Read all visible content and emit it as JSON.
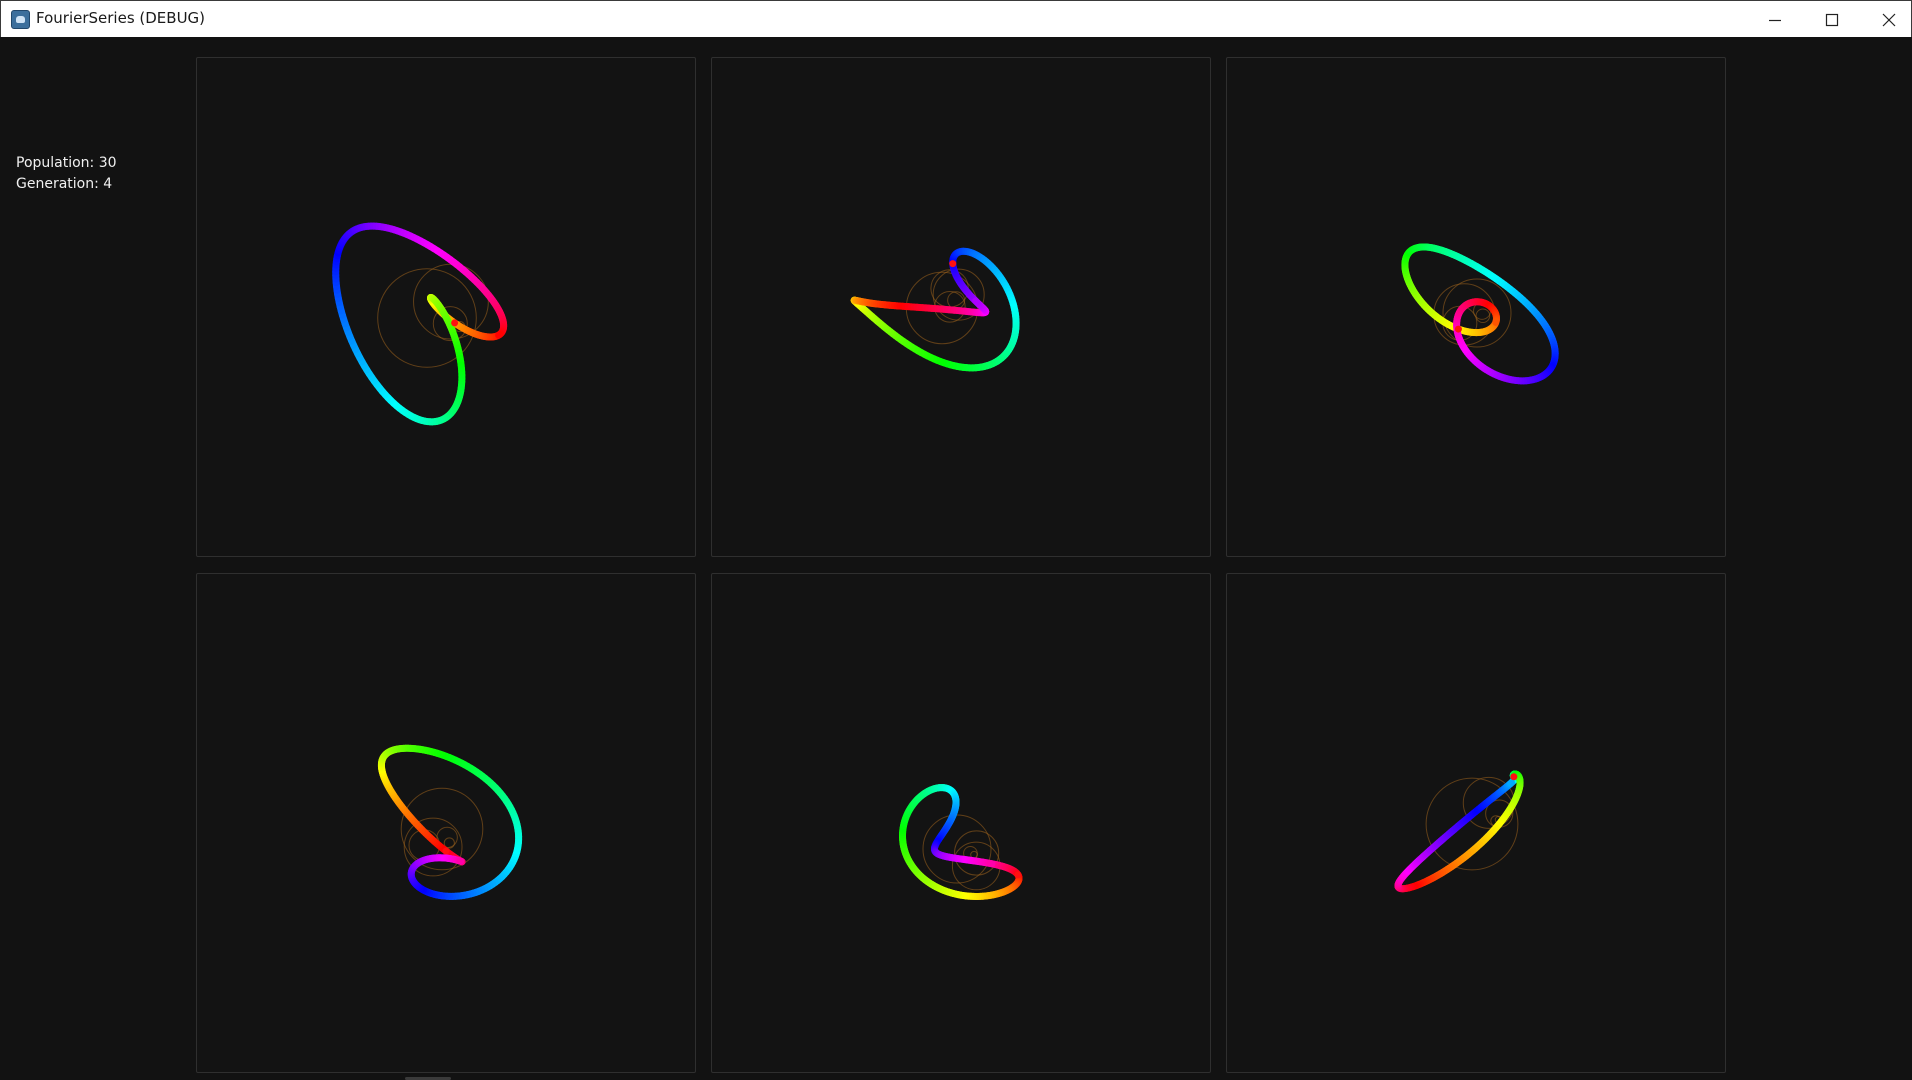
{
  "window": {
    "title": "FourierSeries (DEBUG)",
    "controls": [
      "minimize-icon",
      "maximize-icon",
      "close-icon"
    ]
  },
  "stats": {
    "population": "Population: 30",
    "generation": "Generation: 4"
  },
  "colors": {
    "background": "#121212",
    "panel_border": "#2f2f2f",
    "epicycle": "#a0641e",
    "pen_point": "#ff1010"
  }
}
